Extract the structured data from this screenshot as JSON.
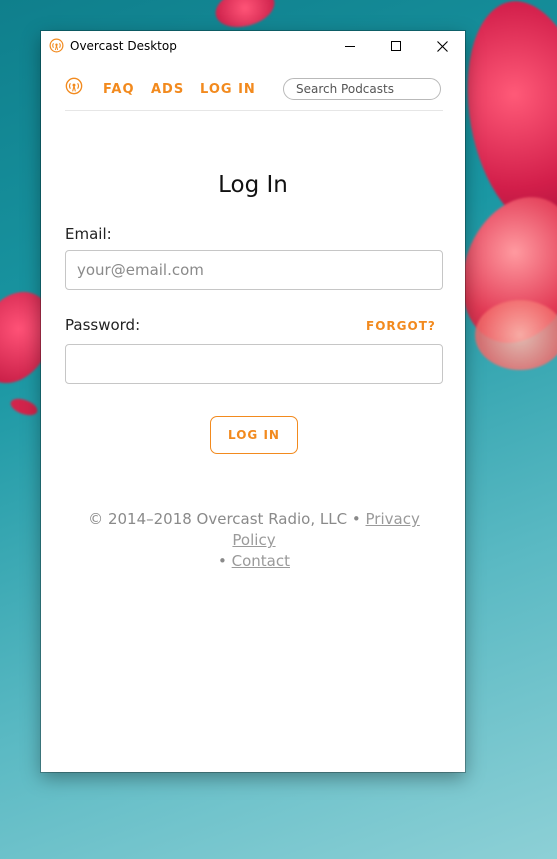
{
  "window": {
    "title": "Overcast Desktop",
    "app_icon": "overcast-logo-icon"
  },
  "nav": {
    "logo": "overcast-logo-icon",
    "faq_label": "FAQ",
    "ads_label": "ADS",
    "login_label": "LOG IN",
    "search_placeholder": "Search Podcasts"
  },
  "form": {
    "heading": "Log In",
    "email_label": "Email:",
    "email_placeholder": "your@email.com",
    "email_value": "",
    "password_label": "Password:",
    "password_value": "",
    "forgot_label": "FORGOT?",
    "submit_label": "LOG IN"
  },
  "footer": {
    "copyright": "© 2014–2018 Overcast Radio, LLC",
    "separator": "•",
    "privacy_label": "Privacy Policy",
    "contact_label": "Contact"
  },
  "colors": {
    "accent": "#f28a1e",
    "text": "#222222",
    "muted": "#8a8a8a"
  }
}
